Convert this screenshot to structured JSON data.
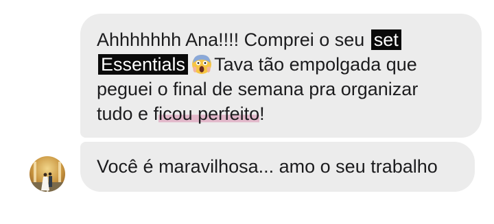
{
  "messages": [
    {
      "line1": {
        "text": "Ahhhhhhh Ana!!!! Comprei o seu",
        "redacted": "set"
      },
      "line2": {
        "redacted": "Essentials",
        "emoji_name": "face-screaming-in-fear-emoji",
        "text": "Tava tão empolgada que"
      },
      "line3": {
        "text": "peguei o final de semana pra organizar"
      },
      "line4": {
        "before": "tudo e f",
        "highlighted": "icou perfeito",
        "after": "!"
      }
    },
    {
      "text": "Você é maravilhosa... amo o seu trabalho",
      "avatar_icon": "wedding-photo-avatar"
    }
  ],
  "colors": {
    "bubble_bg": "#ececec",
    "text": "#1c1c1e",
    "redaction": "#0a0a0a",
    "highlight": "#d678a0"
  }
}
